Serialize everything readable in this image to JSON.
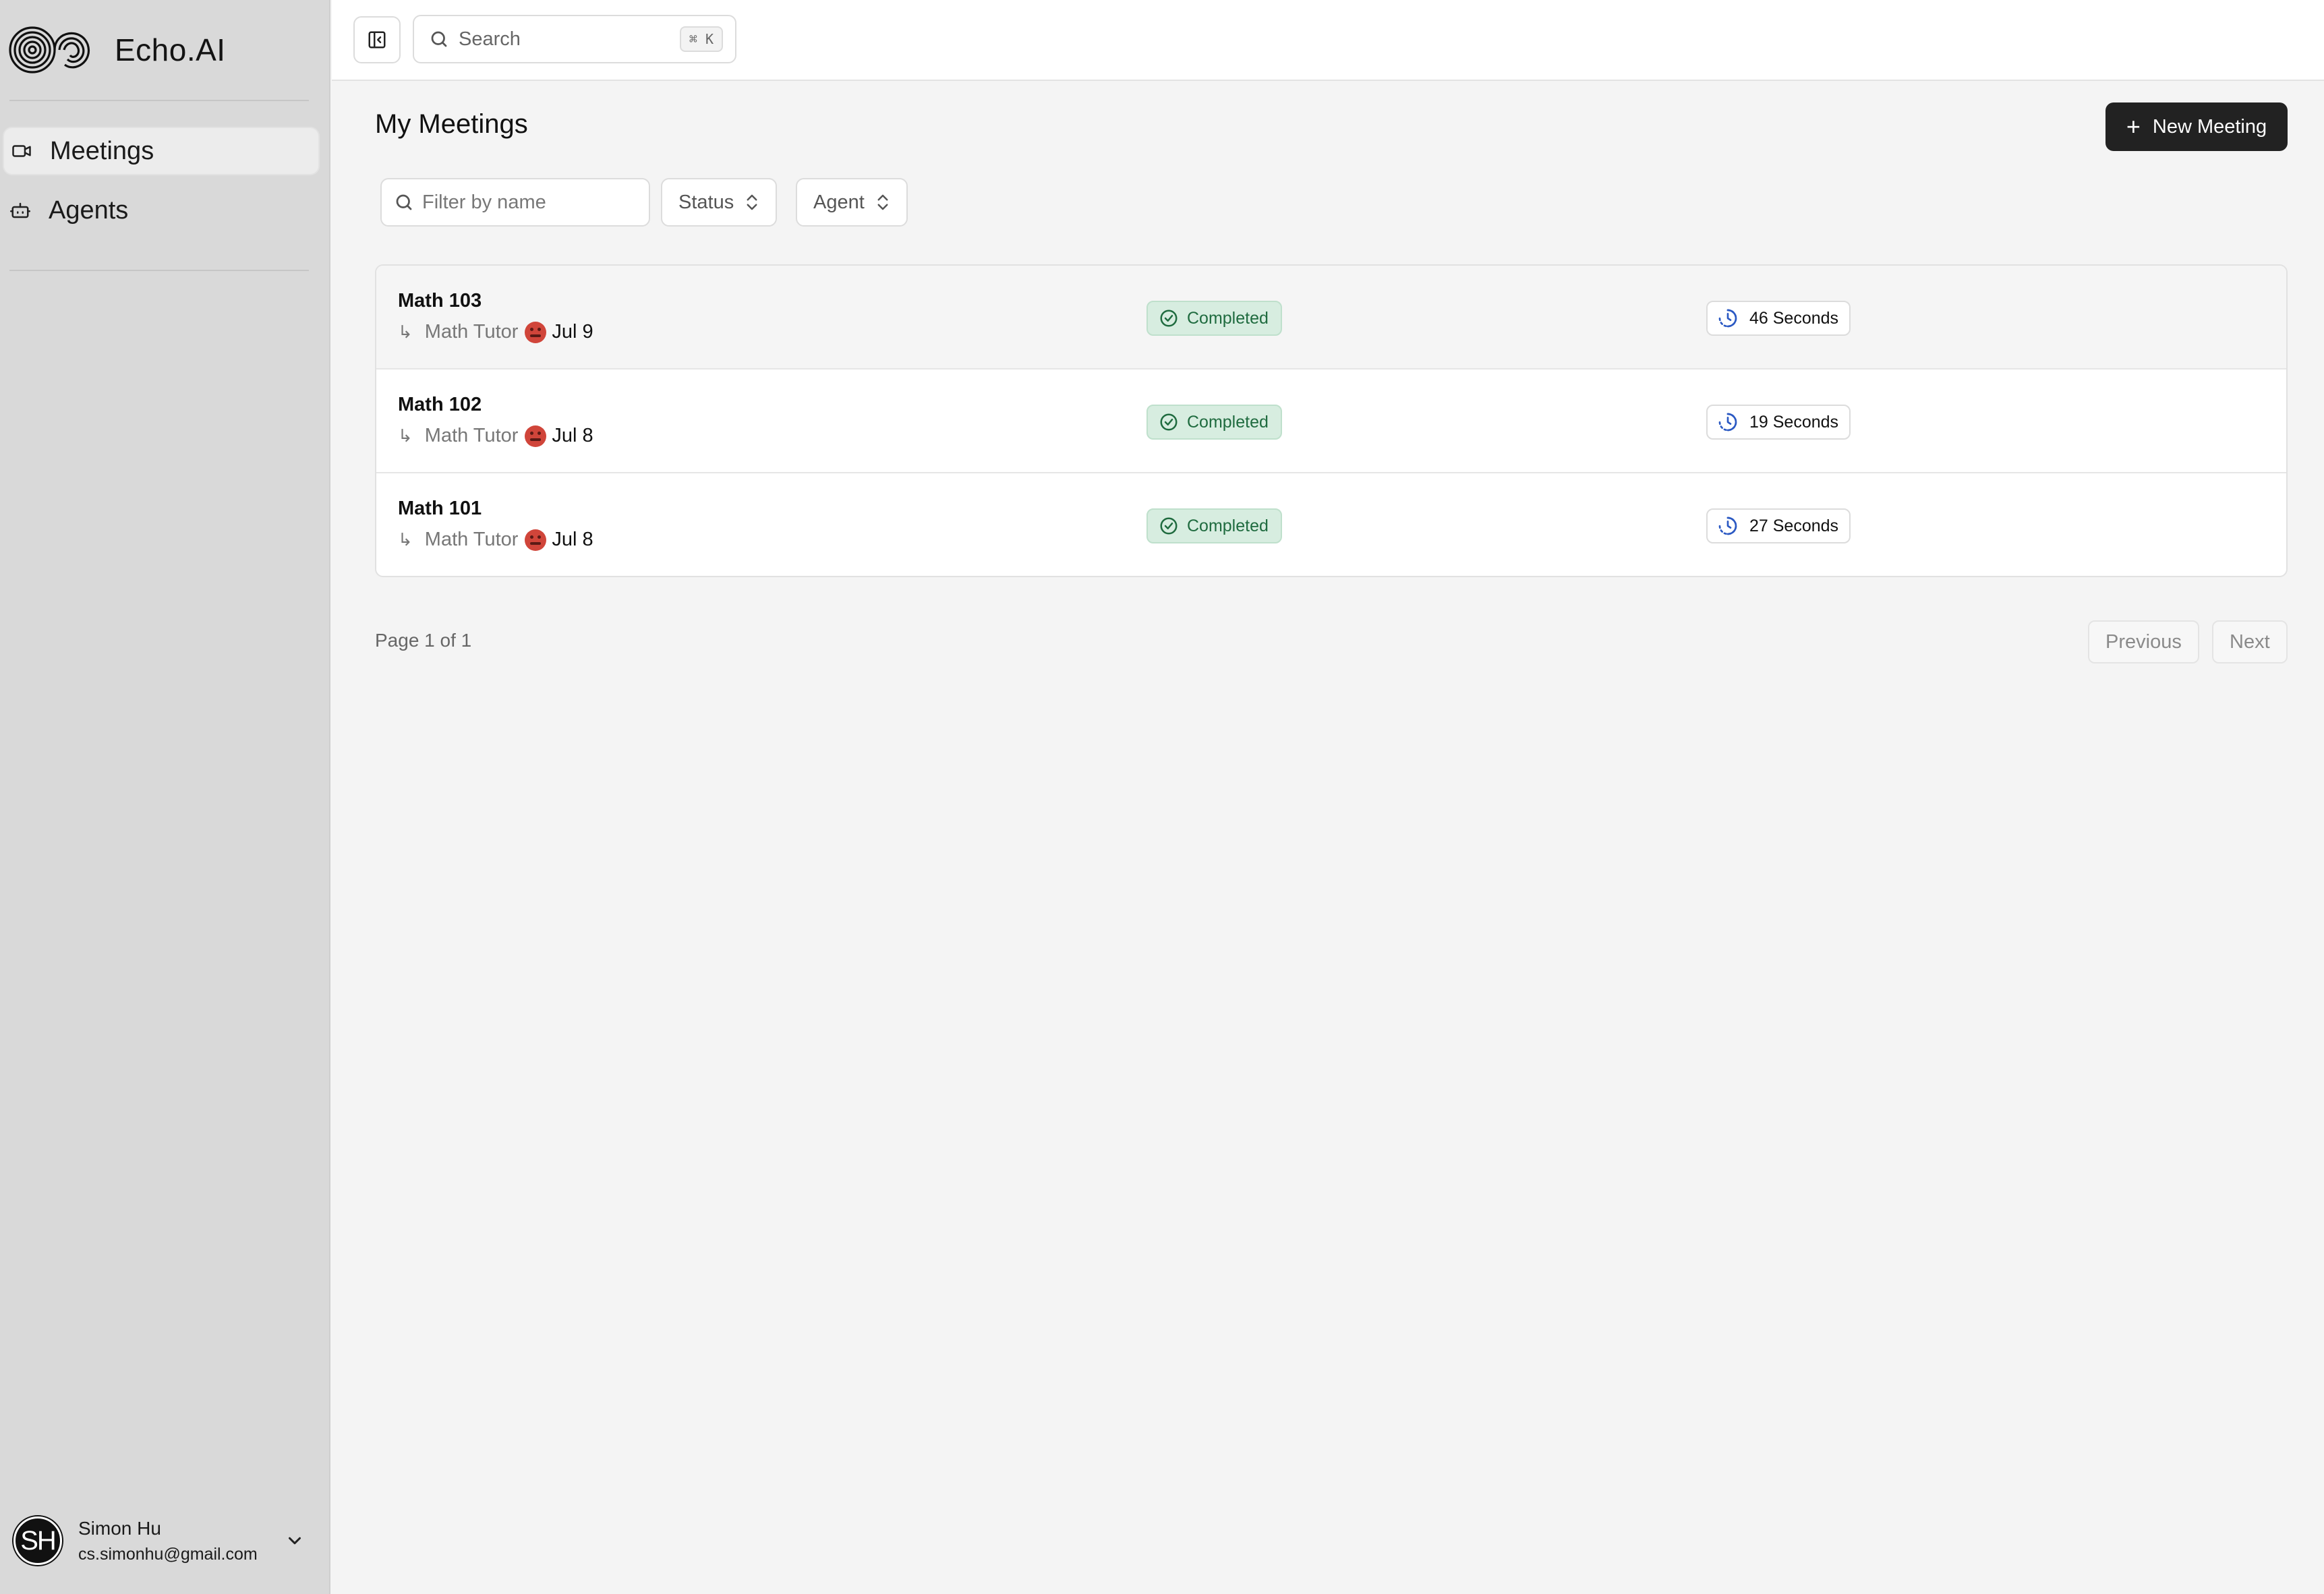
{
  "app": {
    "brand_name": "Echo.AI"
  },
  "sidebar": {
    "items": [
      {
        "label": "Meetings",
        "icon": "video-icon",
        "active": true
      },
      {
        "label": "Agents",
        "icon": "bot-icon",
        "active": false
      }
    ],
    "user": {
      "initials": "SH",
      "name": "Simon Hu",
      "email": "cs.simonhu@gmail.com"
    }
  },
  "topbar": {
    "search_placeholder": "Search",
    "shortcut": "⌘ K"
  },
  "main": {
    "title": "My Meetings",
    "new_button_label": "New Meeting",
    "filters": {
      "name_placeholder": "Filter by name",
      "status_label": "Status",
      "agent_label": "Agent"
    },
    "meetings": [
      {
        "name": "Math 103",
        "agent": "Math Tutor",
        "date": "Jul 9",
        "status": "Completed",
        "duration": "46 Seconds"
      },
      {
        "name": "Math 102",
        "agent": "Math Tutor",
        "date": "Jul 8",
        "status": "Completed",
        "duration": "19 Seconds"
      },
      {
        "name": "Math 101",
        "agent": "Math Tutor",
        "date": "Jul 8",
        "status": "Completed",
        "duration": "27 Seconds"
      }
    ],
    "pagination": {
      "info": "Page 1 of 1",
      "previous_label": "Previous",
      "next_label": "Next"
    }
  },
  "colors": {
    "sidebar_bg": "#d9d9d9",
    "main_bg": "#f4f4f4",
    "primary_button": "#222222",
    "status_completed_bg": "#d7ede0",
    "status_completed_text": "#1f6b3f",
    "duration_icon": "#2b59c3",
    "agent_avatar": "#d0453a"
  }
}
